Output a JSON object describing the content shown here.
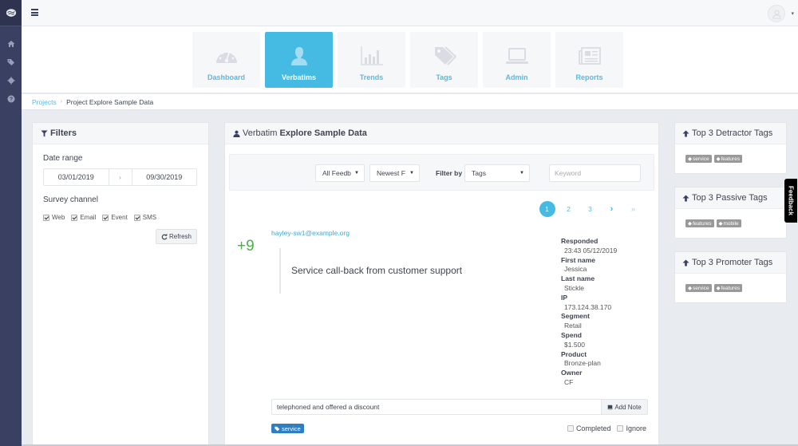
{
  "sidebar": {
    "logo_icon": "brain-logo-icon",
    "items": [
      {
        "icon": "home-icon"
      },
      {
        "icon": "tags-icon"
      },
      {
        "icon": "gear-icon"
      },
      {
        "icon": "help-icon"
      }
    ]
  },
  "topbar": {
    "menu_icon": "hamburger-icon",
    "user_icon": "user-avatar-icon"
  },
  "modules": [
    {
      "label": "Dashboard",
      "icon": "dashboard-gauge-icon",
      "active": false
    },
    {
      "label": "Verbatims",
      "icon": "user-icon",
      "active": true
    },
    {
      "label": "Trends",
      "icon": "bar-chart-icon",
      "active": false
    },
    {
      "label": "Tags",
      "icon": "tags-icon",
      "active": false
    },
    {
      "label": "Admin",
      "icon": "laptop-icon",
      "active": false
    },
    {
      "label": "Reports",
      "icon": "newspaper-icon",
      "active": false
    }
  ],
  "breadcrumb": {
    "link": "Projects",
    "separator": "›",
    "current": "Project Explore Sample Data"
  },
  "filters": {
    "title": "Filters",
    "date_range_label": "Date range",
    "date_from": "03/01/2019",
    "date_arrow": "›",
    "date_to": "09/30/2019",
    "survey_channel_label": "Survey channel",
    "channels": [
      {
        "label": "Web",
        "checked": true
      },
      {
        "label": "Email",
        "checked": true
      },
      {
        "label": "Event",
        "checked": true
      },
      {
        "label": "SMS",
        "checked": true
      }
    ],
    "refresh_label": "Refresh"
  },
  "verbatim": {
    "title_prefix": "Verbatim",
    "title_project": "Explore Sample Data",
    "feedback_select": "All Feedb",
    "sort_select": "Newest F",
    "filter_by_label": "Filter by",
    "filter_by_select": "Tags",
    "keyword_placeholder": "Keyword",
    "pagination": [
      "1",
      "2",
      "3",
      "›",
      "»"
    ],
    "current_page": "1",
    "entry": {
      "email": "hayley-sw1@example.org",
      "score": "+9",
      "text": "Service call-back from customer support",
      "meta": [
        {
          "key": "Responded",
          "value": "23:43 05/12/2019"
        },
        {
          "key": "First name",
          "value": "Jessica"
        },
        {
          "key": "Last name",
          "value": "Stickle"
        },
        {
          "key": "IP",
          "value": "173.124.38.170"
        },
        {
          "key": "Segment",
          "value": "Retail"
        },
        {
          "key": "Spend",
          "value": "$1.500"
        },
        {
          "key": "Product",
          "value": "Bronze-plan"
        },
        {
          "key": "Owner",
          "value": "CF"
        }
      ],
      "note_value": "telephoned and offered a discount",
      "add_note_label": "Add Note",
      "tag": "service",
      "completed_label": "Completed",
      "completed": false,
      "ignore_label": "Ignore",
      "ignore": false
    }
  },
  "tag_panels": [
    {
      "title": "Top 3 Detractor Tags",
      "tags": [
        "service",
        "features"
      ]
    },
    {
      "title": "Top 3 Passive Tags",
      "tags": [
        "features",
        "mobile"
      ]
    },
    {
      "title": "Top 3 Promoter Tags",
      "tags": [
        "service",
        "features"
      ]
    }
  ],
  "feedback_tab": "Feedback",
  "colors": {
    "sidebar": "#3a4062",
    "accent": "#45bae3",
    "score_positive": "#4cae4c",
    "tag_blue": "#2e7fc1",
    "tag_gray": "#999999"
  }
}
